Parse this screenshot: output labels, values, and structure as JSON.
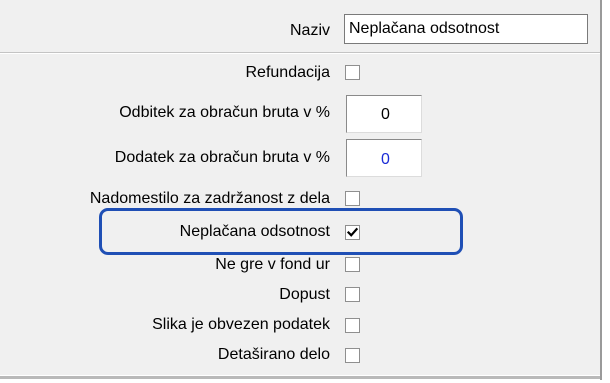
{
  "form": {
    "naziv_label": "Naziv",
    "naziv_value": "Neplačana odsotnost",
    "refundacija_label": "Refundacija",
    "refundacija_checked": false,
    "odbitek_label": "Odbitek za obračun bruta v %",
    "odbitek_value": "0",
    "dodatek_label": "Dodatek za obračun bruta v %",
    "dodatek_value": "0",
    "nadomestilo_label": "Nadomestilo za zadržanost z dela",
    "nadomestilo_checked": false,
    "neplacana_label": "Neplačana odsotnost",
    "neplacana_checked": true,
    "ne_gre_label": "Ne gre v fond ur",
    "ne_gre_checked": false,
    "dopust_label": "Dopust",
    "dopust_checked": false,
    "slika_label": "Slika je obvezen podatek",
    "slika_checked": false,
    "detasirano_label": "Detaširano delo",
    "detasirano_checked": false
  },
  "colors": {
    "highlight": "#1f4fb5",
    "dodatek_value_color": "#1a2bd6"
  },
  "icons": {
    "checkmark": "check-icon"
  }
}
